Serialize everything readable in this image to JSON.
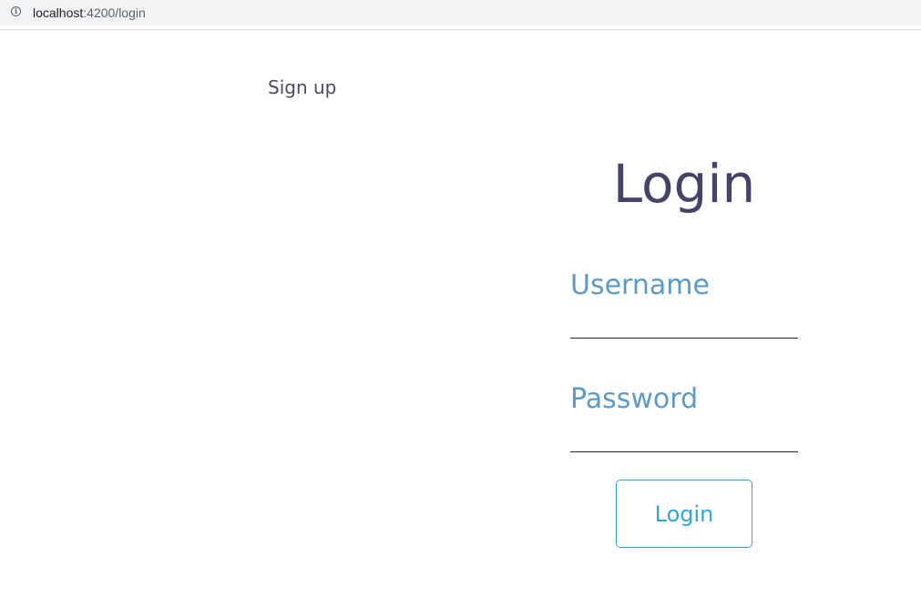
{
  "browser": {
    "url_host": "localhost",
    "url_rest": ":4200/login",
    "info_icon": "info-circle-icon"
  },
  "nav": {
    "signup_label": "Sign up"
  },
  "login_form": {
    "title": "Login",
    "username_label": "Username",
    "username_value": "",
    "password_label": "Password",
    "password_value": "",
    "submit_label": "Login"
  },
  "colors": {
    "title": "#44446a",
    "field_label": "#5b9bc8",
    "button_accent": "#2aa7dc",
    "signup_text": "#4a4a6a"
  }
}
